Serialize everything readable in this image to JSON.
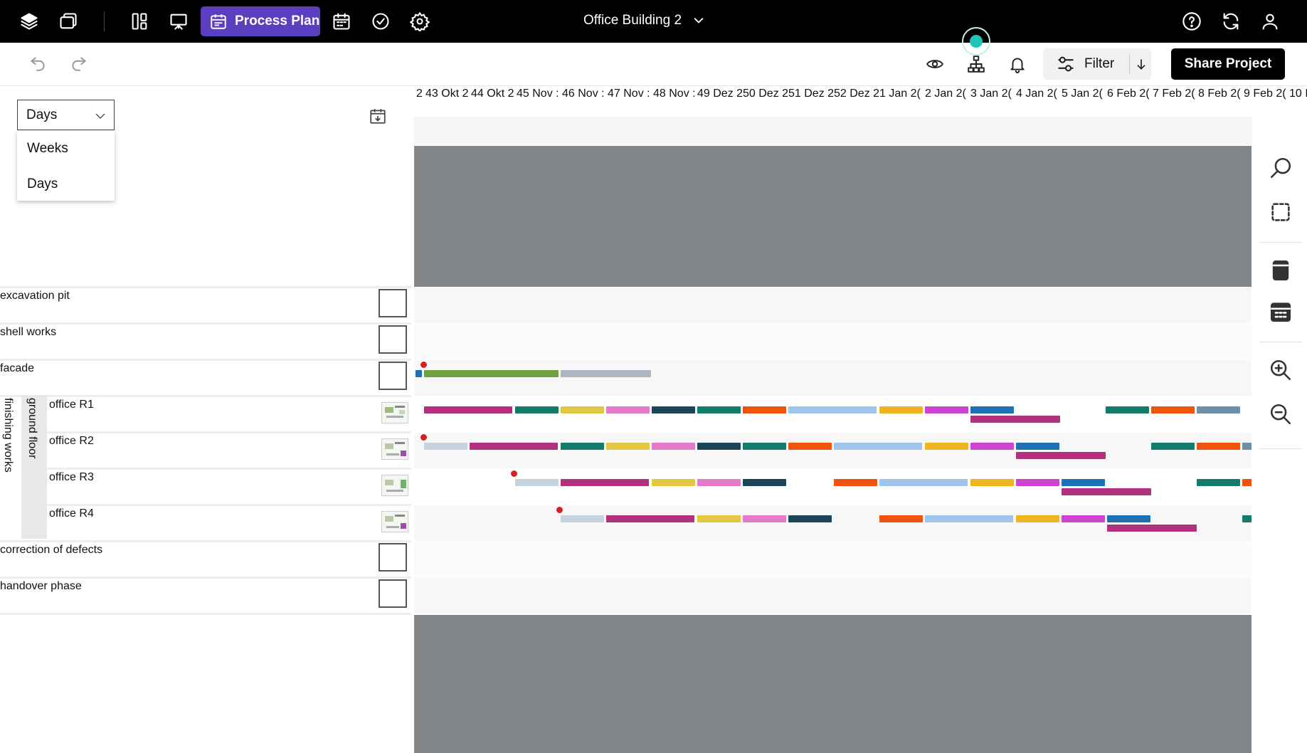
{
  "topbar": {
    "process_plan_label": "Process Plan",
    "project_title": "Office Building 2",
    "icons": [
      "layers-icon",
      "files-icon",
      "layout-icon",
      "presentation-icon",
      "calendar-icon",
      "calendar-icon",
      "check-circle-icon",
      "settings-icon",
      "help-icon",
      "sync-icon",
      "user-icon"
    ]
  },
  "toolbar": {
    "filter_label": "Filter",
    "share_label": "Share Project"
  },
  "scale": {
    "selected": "Days",
    "options": [
      "Weeks",
      "Days"
    ]
  },
  "timeline_header": [
    "2",
    "43 Okt 2",
    "44 Okt 2",
    "45 Nov :",
    "46 Nov :",
    "47 Nov :",
    "48 Nov :",
    "49 Dez 2",
    "50 Dez 2",
    "51 Dez 2",
    "52 Dez 2",
    "1 Jan 2(",
    "2 Jan 2(",
    "3 Jan 2(",
    "4 Jan 2(",
    "5 Jan 2(",
    "6 Feb 2(",
    "7 Feb 2(",
    "8 Feb 2(",
    "9 Feb 2(",
    "10 I"
  ],
  "rows": {
    "excavation": "excavation pit",
    "shell": "shell works",
    "facade": "facade",
    "finishing": "finishing works",
    "ground_floor": "ground floor",
    "office_r1": "office R1",
    "office_r2": "office R2",
    "office_r3": "office R3",
    "office_r4": "office R4",
    "correction": "correction of defects",
    "handover": "handover phase"
  },
  "colors": {
    "accent": "#5b3fbf",
    "topbar": "#000000",
    "grey_block": "#838689",
    "live_dot": "#1fc6b6"
  }
}
